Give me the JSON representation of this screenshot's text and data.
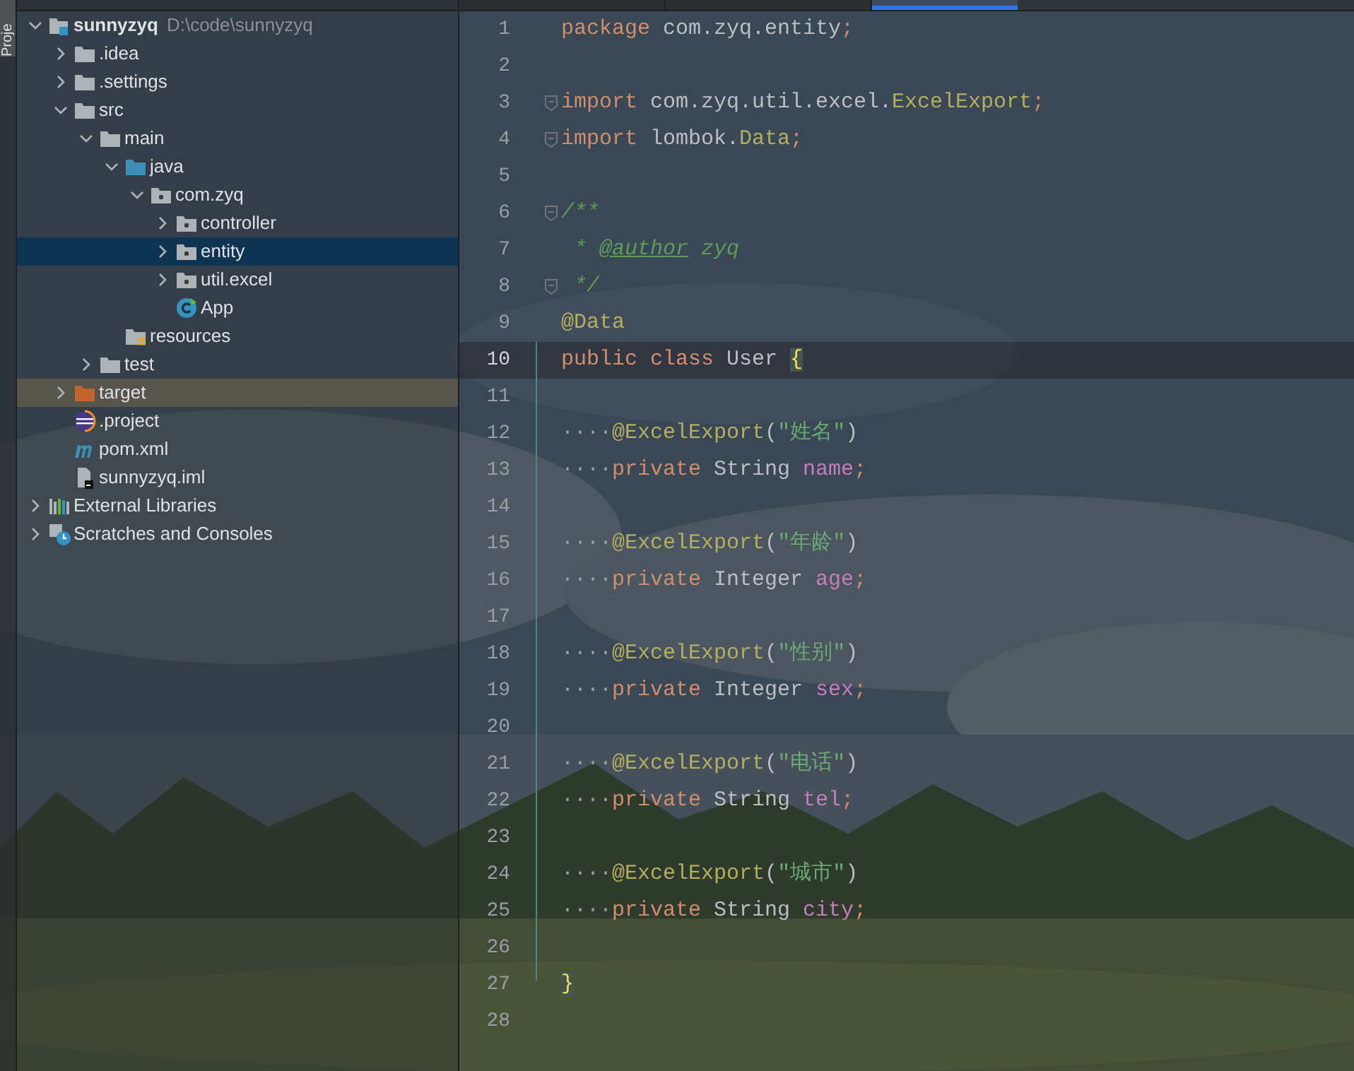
{
  "tool_window_tab": {
    "label": "Proje"
  },
  "editor_tabs": [
    {
      "selected": false
    },
    {
      "selected": false
    },
    {
      "selected": true
    }
  ],
  "project_tree": [
    {
      "label": "sunnyzyq",
      "hint": "D:\\code\\sunnyzyq",
      "kind": "project",
      "expanded": true,
      "selected": false,
      "highlighted": false,
      "children": [
        {
          "label": ".idea",
          "kind": "folder",
          "expanded": false,
          "selected": false,
          "highlighted": false
        },
        {
          "label": ".settings",
          "kind": "folder",
          "expanded": false,
          "selected": false,
          "highlighted": false
        },
        {
          "label": "src",
          "kind": "folder",
          "expanded": true,
          "selected": false,
          "highlighted": false,
          "children": [
            {
              "label": "main",
              "kind": "folder",
              "expanded": true,
              "selected": false,
              "highlighted": false,
              "children": [
                {
                  "label": "java",
                  "kind": "source_folder",
                  "expanded": true,
                  "selected": false,
                  "highlighted": false,
                  "children": [
                    {
                      "label": "com.zyq",
                      "kind": "package",
                      "expanded": true,
                      "selected": false,
                      "highlighted": false,
                      "children": [
                        {
                          "label": "controller",
                          "kind": "package",
                          "expanded": false,
                          "selected": false,
                          "highlighted": false
                        },
                        {
                          "label": "entity",
                          "kind": "package",
                          "expanded": false,
                          "selected": true,
                          "highlighted": false
                        },
                        {
                          "label": "util.excel",
                          "kind": "package",
                          "expanded": false,
                          "selected": false,
                          "highlighted": false
                        },
                        {
                          "label": "App",
                          "kind": "class",
                          "selected": false,
                          "highlighted": false
                        }
                      ]
                    }
                  ]
                },
                {
                  "label": "resources",
                  "kind": "resources",
                  "selected": false,
                  "highlighted": false
                }
              ]
            },
            {
              "label": "test",
              "kind": "folder",
              "expanded": false,
              "selected": false,
              "highlighted": false
            }
          ]
        },
        {
          "label": "target",
          "kind": "excluded_folder",
          "expanded": false,
          "selected": false,
          "highlighted": true
        },
        {
          "label": ".project",
          "kind": "eclipse",
          "selected": false,
          "highlighted": false
        },
        {
          "label": "pom.xml",
          "kind": "maven",
          "selected": false,
          "highlighted": false
        },
        {
          "label": "sunnyzyq.iml",
          "kind": "iml",
          "selected": false,
          "highlighted": false
        }
      ]
    },
    {
      "label": "External Libraries",
      "kind": "libraries",
      "expanded": false,
      "selected": false,
      "highlighted": false
    },
    {
      "label": "Scratches and Consoles",
      "kind": "scratches",
      "expanded": false,
      "selected": false,
      "highlighted": false
    }
  ],
  "editor": {
    "lines": [
      {
        "number": "1",
        "current": false,
        "fold": false,
        "tokens": [
          {
            "kind": "keyword",
            "text": "package"
          },
          {
            "kind": "plain",
            "text": " com.zyq.entity"
          },
          {
            "kind": "punct",
            "text": ";"
          }
        ]
      },
      {
        "number": "2",
        "current": false,
        "fold": false
      },
      {
        "number": "3",
        "current": false,
        "fold": true,
        "tokens": [
          {
            "kind": "keyword",
            "text": "import"
          },
          {
            "kind": "plain",
            "text": " com.zyq.util.excel."
          },
          {
            "kind": "type",
            "text": "ExcelExport"
          },
          {
            "kind": "punct",
            "text": ";"
          }
        ]
      },
      {
        "number": "4",
        "current": false,
        "fold": true,
        "tokens": [
          {
            "kind": "keyword",
            "text": "import"
          },
          {
            "kind": "plain",
            "text": " lombok."
          },
          {
            "kind": "type",
            "text": "Data"
          },
          {
            "kind": "punct",
            "text": ";"
          }
        ]
      },
      {
        "number": "5",
        "current": false,
        "fold": false
      },
      {
        "number": "6",
        "current": false,
        "fold": true,
        "tokens": [
          {
            "kind": "comment",
            "text": "/**"
          }
        ]
      },
      {
        "number": "7",
        "current": false,
        "fold": false,
        "tokens": [
          {
            "kind": "comment",
            "text": " * "
          },
          {
            "kind": "doctag",
            "text": "@author"
          },
          {
            "kind": "comment",
            "text": " zyq"
          }
        ]
      },
      {
        "number": "8",
        "current": false,
        "fold": true,
        "tokens": [
          {
            "kind": "comment",
            "text": " */"
          }
        ]
      },
      {
        "number": "9",
        "current": false,
        "fold": false,
        "tokens": [
          {
            "kind": "annotation",
            "text": "@Data"
          }
        ]
      },
      {
        "number": "10",
        "current": true,
        "fold": false,
        "tokens": [
          {
            "kind": "keyword",
            "text": "public class"
          },
          {
            "kind": "plain",
            "text": " User "
          },
          {
            "kind": "brace",
            "text": "{"
          }
        ]
      },
      {
        "number": "11",
        "current": false,
        "fold": false
      },
      {
        "number": "12",
        "current": false,
        "fold": false,
        "tokens": [
          {
            "kind": "whitespace",
            "text": "····"
          },
          {
            "kind": "annotation",
            "text": "@ExcelExport"
          },
          {
            "kind": "plain",
            "text": "("
          },
          {
            "kind": "string",
            "text": "\"姓名\""
          },
          {
            "kind": "plain",
            "text": ")"
          }
        ]
      },
      {
        "number": "13",
        "current": false,
        "fold": false,
        "tokens": [
          {
            "kind": "whitespace",
            "text": "····"
          },
          {
            "kind": "keyword",
            "text": "private"
          },
          {
            "kind": "plain",
            "text": " String "
          },
          {
            "kind": "field",
            "text": "name"
          },
          {
            "kind": "punct",
            "text": ";"
          }
        ]
      },
      {
        "number": "14",
        "current": false,
        "fold": false
      },
      {
        "number": "15",
        "current": false,
        "fold": false,
        "tokens": [
          {
            "kind": "whitespace",
            "text": "····"
          },
          {
            "kind": "annotation",
            "text": "@ExcelExport"
          },
          {
            "kind": "plain",
            "text": "("
          },
          {
            "kind": "string",
            "text": "\"年龄\""
          },
          {
            "kind": "plain",
            "text": ")"
          }
        ]
      },
      {
        "number": "16",
        "current": false,
        "fold": false,
        "tokens": [
          {
            "kind": "whitespace",
            "text": "····"
          },
          {
            "kind": "keyword",
            "text": "private"
          },
          {
            "kind": "plain",
            "text": " Integer "
          },
          {
            "kind": "field",
            "text": "age"
          },
          {
            "kind": "punct",
            "text": ";"
          }
        ]
      },
      {
        "number": "17",
        "current": false,
        "fold": false
      },
      {
        "number": "18",
        "current": false,
        "fold": false,
        "tokens": [
          {
            "kind": "whitespace",
            "text": "····"
          },
          {
            "kind": "annotation",
            "text": "@ExcelExport"
          },
          {
            "kind": "plain",
            "text": "("
          },
          {
            "kind": "string",
            "text": "\"性别\""
          },
          {
            "kind": "plain",
            "text": ")"
          }
        ]
      },
      {
        "number": "19",
        "current": false,
        "fold": false,
        "tokens": [
          {
            "kind": "whitespace",
            "text": "····"
          },
          {
            "kind": "keyword",
            "text": "private"
          },
          {
            "kind": "plain",
            "text": " Integer "
          },
          {
            "kind": "field",
            "text": "sex"
          },
          {
            "kind": "punct",
            "text": ";"
          }
        ]
      },
      {
        "number": "20",
        "current": false,
        "fold": false
      },
      {
        "number": "21",
        "current": false,
        "fold": false,
        "tokens": [
          {
            "kind": "whitespace",
            "text": "····"
          },
          {
            "kind": "annotation",
            "text": "@ExcelExport"
          },
          {
            "kind": "plain",
            "text": "("
          },
          {
            "kind": "string",
            "text": "\"电话\""
          },
          {
            "kind": "plain",
            "text": ")"
          }
        ]
      },
      {
        "number": "22",
        "current": false,
        "fold": false,
        "tokens": [
          {
            "kind": "whitespace",
            "text": "····"
          },
          {
            "kind": "keyword",
            "text": "private"
          },
          {
            "kind": "plain",
            "text": " String "
          },
          {
            "kind": "field",
            "text": "tel"
          },
          {
            "kind": "punct",
            "text": ";"
          }
        ]
      },
      {
        "number": "23",
        "current": false,
        "fold": false
      },
      {
        "number": "24",
        "current": false,
        "fold": false,
        "tokens": [
          {
            "kind": "whitespace",
            "text": "····"
          },
          {
            "kind": "annotation",
            "text": "@ExcelExport"
          },
          {
            "kind": "plain",
            "text": "("
          },
          {
            "kind": "string",
            "text": "\"城市\""
          },
          {
            "kind": "plain",
            "text": ")"
          }
        ]
      },
      {
        "number": "25",
        "current": false,
        "fold": false,
        "tokens": [
          {
            "kind": "whitespace",
            "text": "····"
          },
          {
            "kind": "keyword",
            "text": "private"
          },
          {
            "kind": "plain",
            "text": " String "
          },
          {
            "kind": "field",
            "text": "city"
          },
          {
            "kind": "punct",
            "text": ";"
          }
        ]
      },
      {
        "number": "26",
        "current": false,
        "fold": false
      },
      {
        "number": "27",
        "current": false,
        "fold": false,
        "tokens": [
          {
            "kind": "brace",
            "text": "}"
          }
        ]
      },
      {
        "number": "28",
        "current": false,
        "fold": false
      }
    ]
  }
}
